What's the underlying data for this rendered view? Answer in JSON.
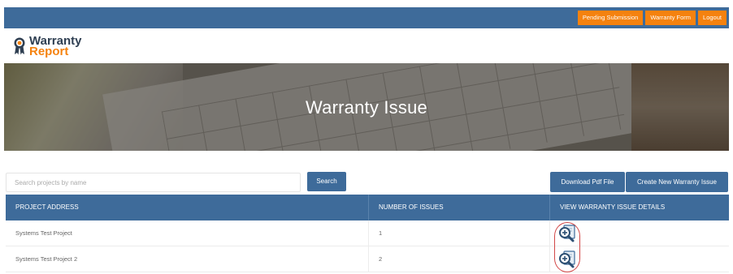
{
  "nav": {
    "pending_label": "Pending Submission",
    "warranty_form_label": "Warranty Form",
    "logout_label": "Logout"
  },
  "logo": {
    "line1": "Warranty",
    "line2": "Report"
  },
  "hero": {
    "title": "Warranty Issue"
  },
  "search": {
    "placeholder": "Search projects by name",
    "value": "",
    "button_label": "Search"
  },
  "actions": {
    "download_label": "Download Pdf File",
    "create_label": "Create New Warranty Issue"
  },
  "table": {
    "headers": [
      "PROJECT ADDRESS",
      "NUMBER OF ISSUES",
      "VIEW WARRANTY ISSUE DETAILS"
    ],
    "rows": [
      {
        "address": "Systems Test Project",
        "issues": "1"
      },
      {
        "address": "Systems Test Project 2",
        "issues": "2"
      }
    ]
  },
  "colors": {
    "primary": "#3e6b9a",
    "accent": "#f5820f",
    "annotation": "#d24848"
  },
  "icons": {
    "logo": "award-ribbon-icon",
    "details": "zoom-in-icon"
  }
}
